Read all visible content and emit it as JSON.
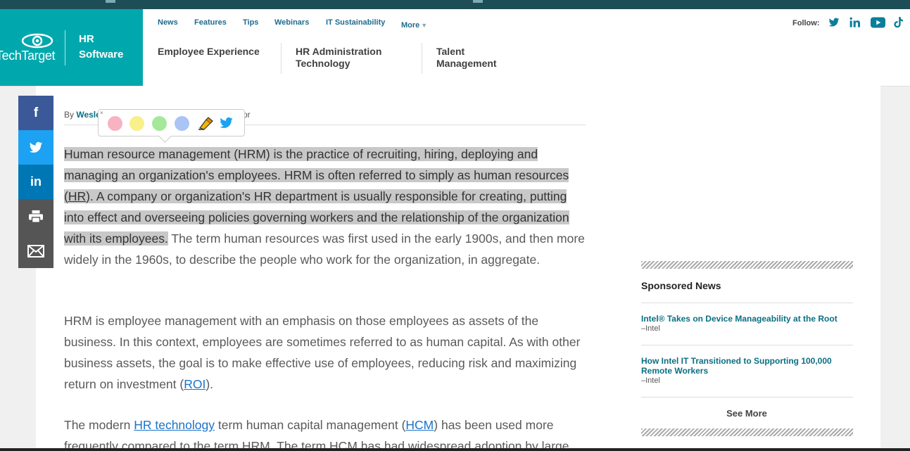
{
  "site": {
    "brand": "TechTarget",
    "section_line1": "HR",
    "section_line2": "Software"
  },
  "topnav": [
    {
      "label": "News"
    },
    {
      "label": "Features"
    },
    {
      "label": "Tips"
    },
    {
      "label": "Webinars"
    },
    {
      "label": "IT Sustainability"
    },
    {
      "label": "More"
    }
  ],
  "mainnav": {
    "item1": "Employee Experience",
    "item2_line1": "HR Administration",
    "item2_line2": "Technology",
    "item3_line1": "Talent",
    "item3_line2": "Management"
  },
  "follow": {
    "label": "Follow:",
    "icons": [
      "twitter-icon",
      "linkedin-icon",
      "youtube-icon",
      "tiktok-icon"
    ]
  },
  "article": {
    "byline_prefix": "By ",
    "author": "Wesle",
    "byline_tail": "or",
    "p1_highlight_a": "Human resource management (HRM) is the practice of recruiting, hiring, deploying and managing an organization's employees. HRM is often referred to simply as human resources (",
    "p1_link_hr": "HR",
    "p1_highlight_b": "). A company or organization's HR department is usually responsible for creating, putting into effect and overseeing policies governing workers and the relationship of the organization with its employees.",
    "p1_rest": " The term human resources was first used in the early 1900s, and then more widely in the 1960s, to describe the people who work for the organization, in aggregate.",
    "p2_a": "HRM is employee management with an emphasis on those employees as assets of the business. In this context, employees are sometimes referred to as human capital. As with other business assets, the goal is to make effective use of employees, reducing risk and maximizing return on investment (",
    "p2_link": "ROI",
    "p2_b": ").",
    "p3_a": "The modern ",
    "p3_link1": "HR technology",
    "p3_b": " term human capital management (",
    "p3_link2": "HCM",
    "p3_c": ") has been used more frequently compared to the term HRM. The term HCM has had widespread adoption by large"
  },
  "highlight_popup": {
    "colors": [
      "#f7b3c2",
      "#f8f08a",
      "#a6e89a",
      "#a9c4f5"
    ],
    "icons": [
      "highlighter-icon",
      "twitter-icon"
    ]
  },
  "share_bar": [
    {
      "icon": "facebook-icon",
      "color": "#3b5998"
    },
    {
      "icon": "twitter-icon",
      "color": "#1da1f2"
    },
    {
      "icon": "linkedin-icon",
      "color": "#0077b5"
    },
    {
      "icon": "print-icon",
      "color": "#555555"
    },
    {
      "icon": "email-icon",
      "color": "#555555"
    }
  ],
  "sponsored": {
    "title": "Sponsored News",
    "items": [
      {
        "title": "Intel® Takes on Device Manageability at the Root",
        "source": "–Intel"
      },
      {
        "title": "How Intel IT Transitioned to Supporting 100,000 Remote Workers",
        "source": "–Intel"
      }
    ],
    "see_more": "See More"
  },
  "colors": {
    "brand_teal": "#00a8ad",
    "nav_link": "#1f6b8f",
    "article_link": "#1a73c9",
    "highlight": "#c8c8c8"
  }
}
